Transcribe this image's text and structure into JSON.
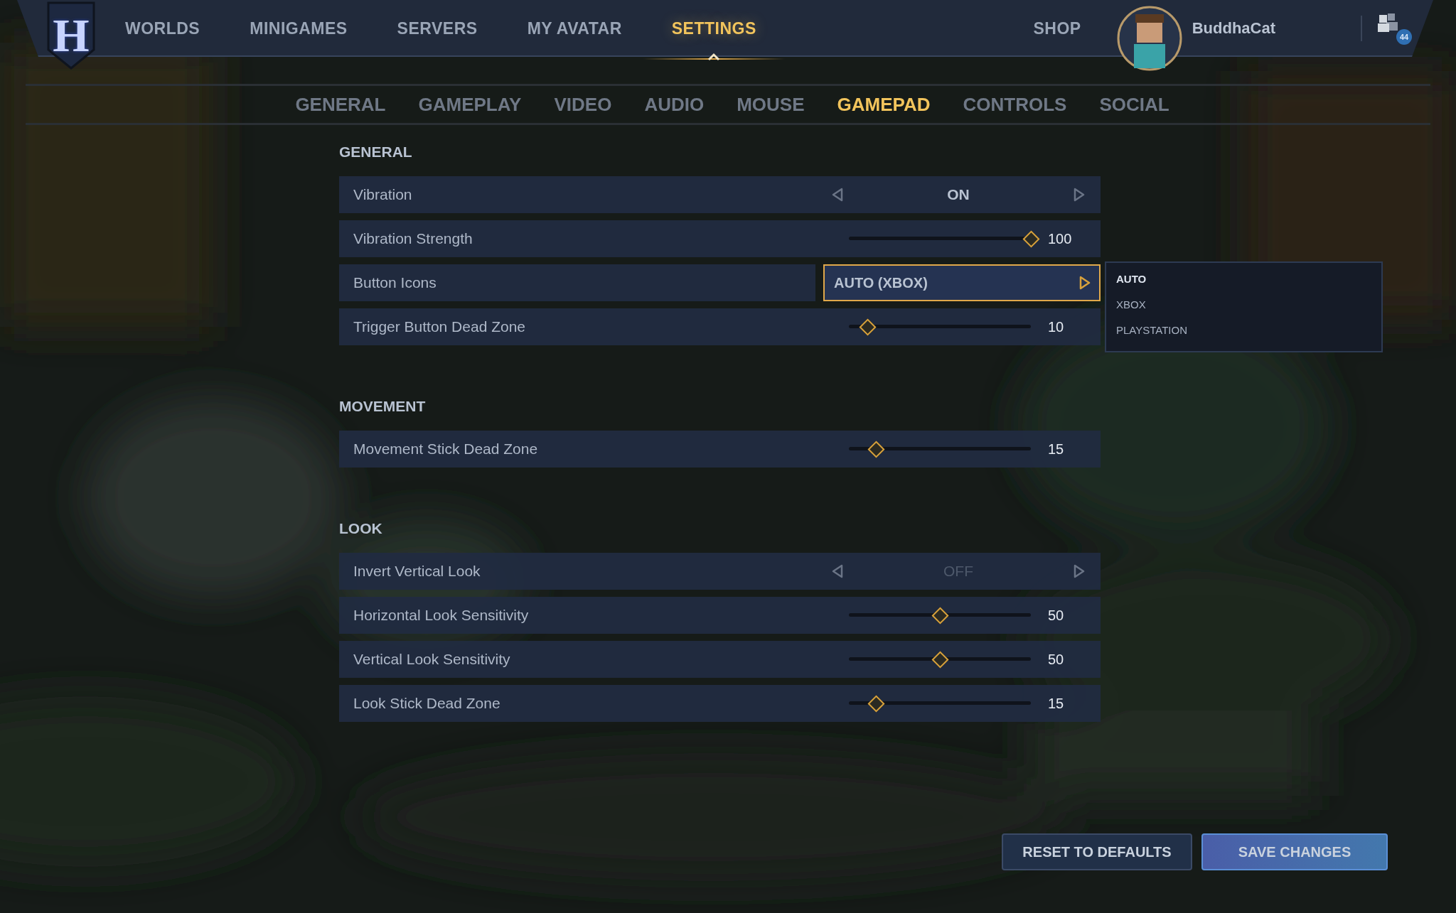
{
  "logo": "H",
  "nav": [
    {
      "label": "WORLDS",
      "selected": false
    },
    {
      "label": "MINIGAMES",
      "selected": false
    },
    {
      "label": "SERVERS",
      "selected": false
    },
    {
      "label": "MY AVATAR",
      "selected": false
    },
    {
      "label": "SETTINGS",
      "selected": true
    }
  ],
  "shop": "SHOP",
  "user": {
    "name": "BuddhaCat"
  },
  "friends": {
    "badge": "44"
  },
  "subtabs": [
    {
      "label": "GENERAL",
      "selected": false
    },
    {
      "label": "GAMEPLAY",
      "selected": false
    },
    {
      "label": "VIDEO",
      "selected": false
    },
    {
      "label": "AUDIO",
      "selected": false
    },
    {
      "label": "MOUSE",
      "selected": false
    },
    {
      "label": "GAMEPAD",
      "selected": true
    },
    {
      "label": "CONTROLS",
      "selected": false
    },
    {
      "label": "SOCIAL",
      "selected": false
    }
  ],
  "sections": [
    {
      "title": "GENERAL",
      "rows": [
        {
          "kind": "toggle",
          "label": "Vibration",
          "value": "ON",
          "on": true
        },
        {
          "kind": "slider",
          "label": "Vibration Strength",
          "level": 1,
          "reading": "100"
        },
        {
          "kind": "dropdown",
          "label": "Button Icons",
          "value": "AUTO (XBOX)",
          "open": true,
          "options": [
            {
              "label": "AUTO",
              "selected": true
            },
            {
              "label": "XBOX",
              "selected": false
            },
            {
              "label": "PLAYSTATION",
              "selected": false
            }
          ]
        },
        {
          "kind": "slider",
          "label": "Trigger Button Dead Zone",
          "level": 0.1,
          "reading": "10"
        }
      ]
    },
    {
      "title": "MOVEMENT",
      "rows": [
        {
          "kind": "slider",
          "label": "Movement Stick Dead Zone",
          "level": 0.15,
          "reading": "15"
        }
      ]
    },
    {
      "title": "LOOK",
      "rows": [
        {
          "kind": "toggle",
          "label": "Invert Vertical Look",
          "value": "OFF",
          "on": false
        },
        {
          "kind": "slider",
          "label": "Horizontal Look Sensitivity",
          "level": 0.5,
          "reading": "50"
        },
        {
          "kind": "slider",
          "label": "Vertical Look Sensitivity",
          "level": 0.5,
          "reading": "50"
        },
        {
          "kind": "slider",
          "label": "Look Stick Dead Zone",
          "level": 0.15,
          "reading": "15"
        }
      ]
    }
  ],
  "buttons": [
    {
      "label": "RESET TO DEFAULTS",
      "kind": "secondary"
    },
    {
      "label": "SAVE CHANGES",
      "kind": "primary"
    }
  ]
}
